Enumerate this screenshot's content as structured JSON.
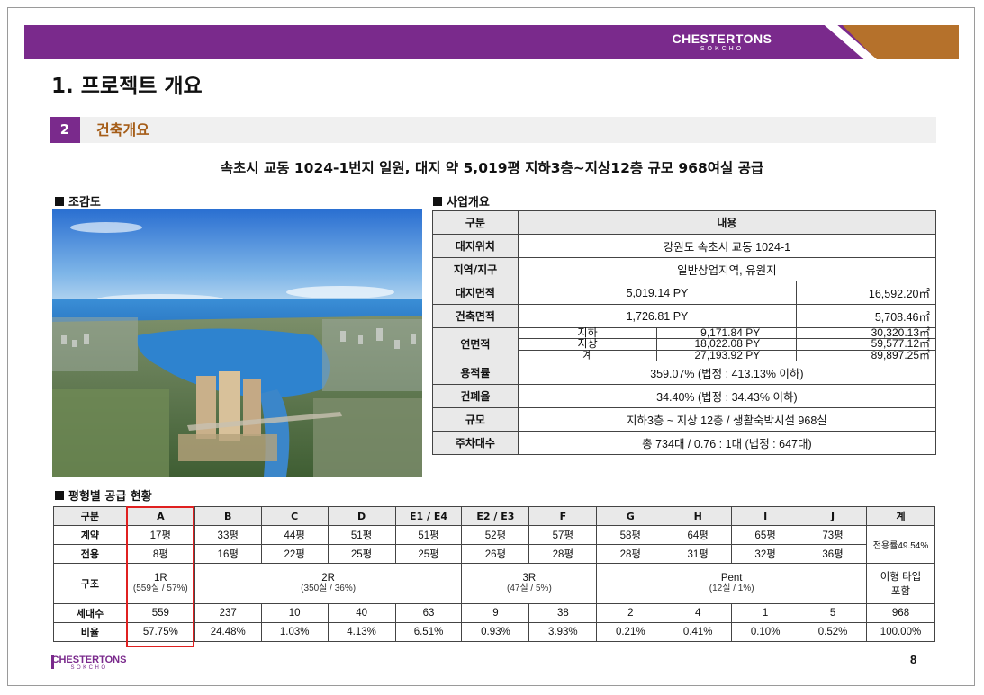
{
  "brand": {
    "name": "CHESTERTONS",
    "sub": "SOKCHO"
  },
  "page_title": "1. 프로젝트 개요",
  "section": {
    "number": "2",
    "title": "건축개요"
  },
  "summary": "속초시 교동 1024-1번지 일원, 대지 약 5,019평 지하3층~지상12층 규모 968여실 공급",
  "aerial_heading": "조감도",
  "business": {
    "heading": "사업개요",
    "col_header_1": "구분",
    "col_header_2": "내용",
    "site_location_label": "대지위치",
    "site_location_value": "강원도 속초시 교동 1024-1",
    "zone_label": "지역/지구",
    "zone_value": "일반상업지역, 유원지",
    "site_area_label": "대지면적",
    "site_area_py": "5,019.14 PY",
    "site_area_m2": "16,592.20㎡",
    "building_area_label": "건축면적",
    "building_area_py": "1,726.81 PY",
    "building_area_m2": "5,708.46㎡",
    "floor_area_label": "연면적",
    "floor_area_rows": [
      {
        "label": "지하",
        "py": "9,171.84 PY",
        "m2": "30,320.13㎡"
      },
      {
        "label": "지상",
        "py": "18,022.08 PY",
        "m2": "59,577.12㎡"
      },
      {
        "label": "계",
        "py": "27,193.92 PY",
        "m2": "89,897.25㎡"
      }
    ],
    "far_label": "용적률",
    "far_value": "359.07% (법정 : 413.13% 이하)",
    "bcr_label": "건폐율",
    "bcr_value": "34.40% (법정 : 34.43% 이하)",
    "scale_label": "규모",
    "scale_value": "지하3층 ~ 지상 12층 / 생활숙박시설 968실",
    "parking_label": "주차대수",
    "parking_value": "총 734대 / 0.76 : 1대 (법정 : 647대)"
  },
  "supply": {
    "heading": "평형별 공급 현황",
    "corner_label": "구분",
    "types": [
      "A",
      "B",
      "C",
      "D",
      "E1 / E4",
      "E2 / E3",
      "F",
      "G",
      "H",
      "I",
      "J"
    ],
    "total_label": "계",
    "contract_label": "계약",
    "contract": [
      "17평",
      "33평",
      "44평",
      "51평",
      "51평",
      "52평",
      "57평",
      "58평",
      "64평",
      "65평",
      "73평"
    ],
    "exclusive_label": "전용",
    "exclusive": [
      "8평",
      "16평",
      "22평",
      "25평",
      "25평",
      "26평",
      "28평",
      "28평",
      "31평",
      "32평",
      "36평"
    ],
    "exclusive_ratio": "전용률49.54%",
    "structure_label": "구조",
    "structure": [
      {
        "name": "1R",
        "detail": "(559실 / 57%)"
      },
      {
        "name": "2R",
        "detail": "(350실 / 36%)"
      },
      {
        "name": "3R",
        "detail": "(47실 / 5%)"
      },
      {
        "name": "Pent",
        "detail": "(12실 / 1%)"
      }
    ],
    "structure_total_1": "이형 타입",
    "structure_total_2": "포함",
    "units_label": "세대수",
    "units": [
      "559",
      "237",
      "10",
      "40",
      "63",
      "9",
      "38",
      "2",
      "4",
      "1",
      "5"
    ],
    "units_total": "968",
    "ratio_label": "비율",
    "ratio": [
      "57.75%",
      "24.48%",
      "1.03%",
      "4.13%",
      "6.51%",
      "0.93%",
      "3.93%",
      "0.21%",
      "0.41%",
      "0.10%",
      "0.52%"
    ],
    "ratio_total": "100.00%"
  },
  "footer": {
    "brand": "CHESTERTONS",
    "sub": "SOKCHO",
    "page_number": "8"
  },
  "colors": {
    "purple": "#7a2a8c",
    "orange": "#b5712b",
    "section_text": "#a55d18",
    "highlight": "#e02020"
  }
}
